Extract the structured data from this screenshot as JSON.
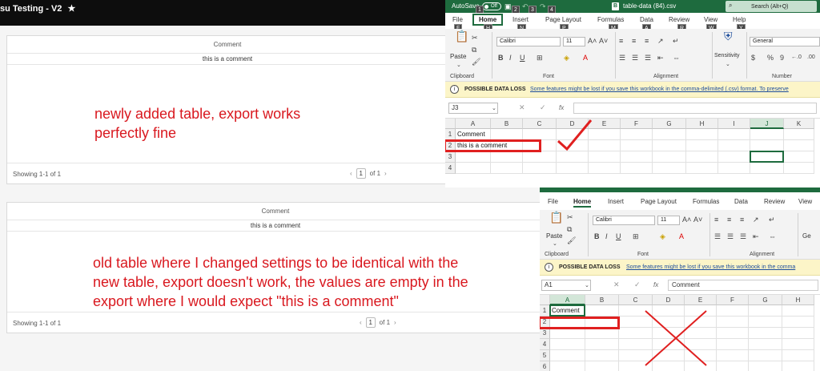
{
  "app": {
    "title": "su Testing - V2",
    "star_icon": "star-icon"
  },
  "panels": [
    {
      "column_header": "Comment",
      "cell_value": "this is a comment",
      "showing": "Showing 1-1 of 1",
      "page": "1",
      "of_pages": "of 1"
    },
    {
      "column_header": "Comment",
      "cell_value": "this is a comment",
      "showing": "Showing 1-1 of 1",
      "page": "1",
      "of_pages": "of 1"
    }
  ],
  "notes": {
    "top": [
      "newly added table, export works",
      "perfectly fine"
    ],
    "bottom": [
      "old table where I changed settings to be identical with the",
      "new table, export doesn't work, the values are empty in the",
      "export where I would expect \"this is a comment\""
    ]
  },
  "excel_top": {
    "autosave": "AutoSave",
    "toggle": "Off",
    "keytips_title": [
      "1",
      "2",
      "3",
      "4"
    ],
    "doc_letter": "B",
    "filename": "table-data (84).csv",
    "search": "Search (Alt+Q)",
    "tabs": [
      "File",
      "Home",
      "Insert",
      "Page Layout",
      "Formulas",
      "Data",
      "Review",
      "View",
      "Help"
    ],
    "tab_keytips": [
      "F",
      "H",
      "N",
      "P",
      "M",
      "A",
      "R",
      "W",
      "Y"
    ],
    "font_name": "Calibri",
    "font_size": "11",
    "paste_label": "Paste",
    "sensitivity_label": "Sensitivity",
    "number_format": "General",
    "ribbon_groups": [
      "Clipboard",
      "Font",
      "Alignment",
      "Number"
    ],
    "infobar": {
      "title": "POSSIBLE DATA LOSS",
      "message": "Some features might be lost if you save this workbook in the comma-delimited (.csv) format. To preserve"
    },
    "name_box": "J3",
    "fx": "fx",
    "columns": [
      "A",
      "B",
      "C",
      "D",
      "E",
      "F",
      "G",
      "H",
      "I",
      "J",
      "K"
    ],
    "rows": [
      "1",
      "2",
      "3",
      "4"
    ],
    "cells": {
      "A1": "Comment",
      "A2": "this is a comment"
    }
  },
  "excel_bottom": {
    "tabs": [
      "File",
      "Home",
      "Insert",
      "Page Layout",
      "Formulas",
      "Data",
      "Review",
      "View"
    ],
    "font_name": "Calibri",
    "font_size": "11",
    "paste_label": "Paste",
    "ribbon_groups": [
      "Clipboard",
      "Font",
      "Alignment"
    ],
    "number_partial": "Ge",
    "infobar": {
      "title": "POSSIBLE DATA LOSS",
      "message": "Some features might be lost if you save this workbook in the comma"
    },
    "name_box": "A1",
    "formula": "Comment",
    "columns": [
      "A",
      "B",
      "C",
      "D",
      "E",
      "F",
      "G",
      "H"
    ],
    "rows": [
      "1",
      "2",
      "3",
      "4",
      "5",
      "6"
    ],
    "cells": {
      "A1": "Comment"
    }
  },
  "colors": {
    "excel_green": "#1e6b3e",
    "annotation_red": "#d9181f",
    "infobar_yellow": "#fcf5c8"
  }
}
